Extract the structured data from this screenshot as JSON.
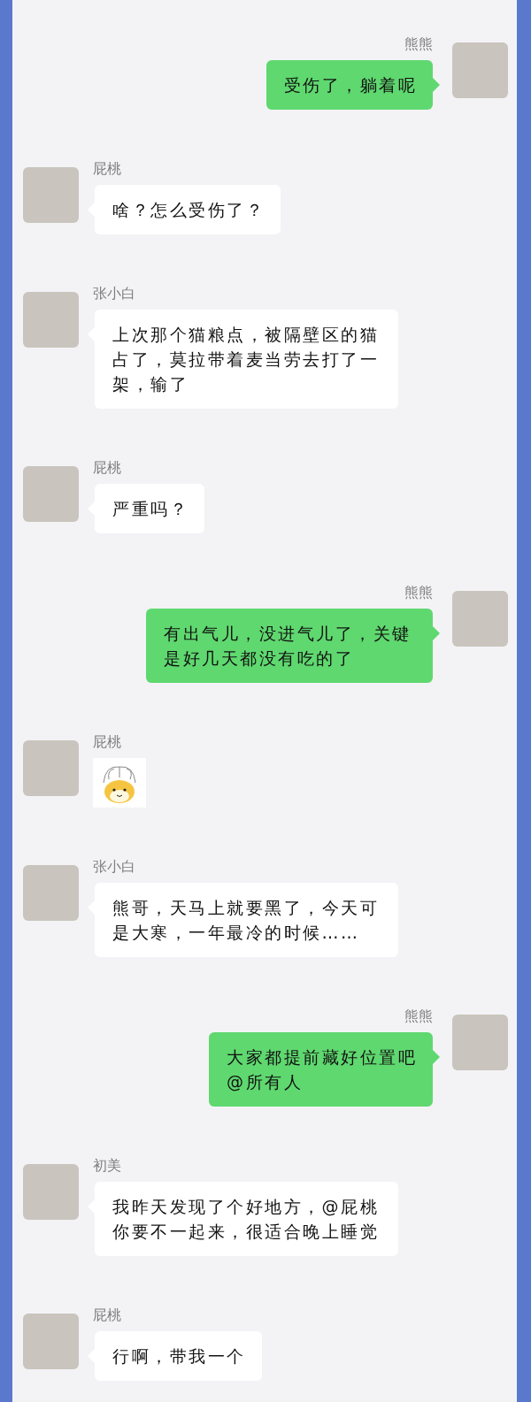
{
  "messages": [
    {
      "sender": "熊熊",
      "outgoing": true,
      "kind": "text",
      "text": "受伤了，躺着呢"
    },
    {
      "sender": "屁桃",
      "outgoing": false,
      "kind": "text",
      "text": "啥？怎么受伤了？"
    },
    {
      "sender": "张小白",
      "outgoing": false,
      "kind": "text",
      "text": "上次那个猫粮点，被隔壁区的猫占了，莫拉带着麦当劳去打了一架，输了"
    },
    {
      "sender": "屁桃",
      "outgoing": false,
      "kind": "text",
      "text": "严重吗？"
    },
    {
      "sender": "熊熊",
      "outgoing": true,
      "kind": "text",
      "text": "有出气儿，没进气儿了，关键是好几天都没有吃的了"
    },
    {
      "sender": "屁桃",
      "kind": "sticker"
    },
    {
      "sender": "张小白",
      "outgoing": false,
      "kind": "text",
      "text": "熊哥，天马上就要黑了，今天可是大寒，一年最冷的时候……"
    },
    {
      "sender": "熊熊",
      "outgoing": true,
      "kind": "lines",
      "lines": [
        "大家都提前藏好位置吧",
        "@所有人"
      ]
    },
    {
      "sender": "初美",
      "outgoing": false,
      "kind": "text",
      "text": "我昨天发现了个好地方，@屁桃你要不一起来，很适合晚上睡觉"
    },
    {
      "sender": "屁桃",
      "outgoing": false,
      "kind": "text",
      "text": "行啊，带我一个"
    }
  ]
}
